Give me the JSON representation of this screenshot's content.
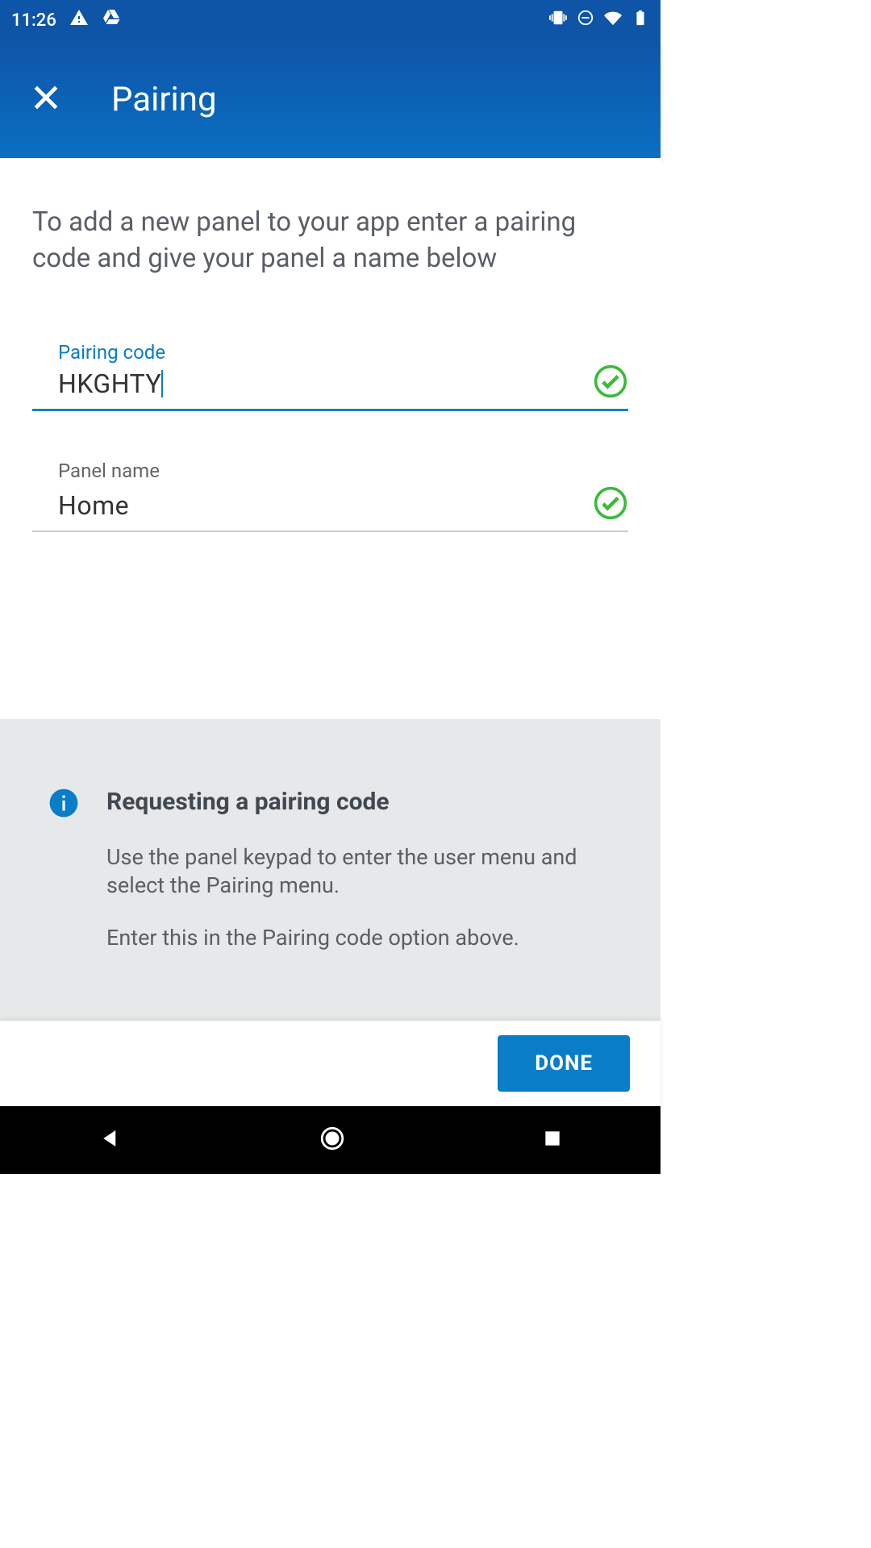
{
  "status_bar": {
    "time": "11:26"
  },
  "header": {
    "title": "Pairing"
  },
  "instructions": "To add a new panel to your app enter a pairing code and give your panel a name below",
  "fields": {
    "pairing_code": {
      "label": "Pairing code",
      "value": "HKGHTY"
    },
    "panel_name": {
      "label": "Panel name",
      "value": "Home"
    }
  },
  "info_box": {
    "title": "Requesting a pairing code",
    "paragraph1": "Use the panel keypad to enter the user menu and select the Pairing menu.",
    "paragraph2": "Enter this in the Pairing code option above."
  },
  "buttons": {
    "done": "DONE"
  }
}
